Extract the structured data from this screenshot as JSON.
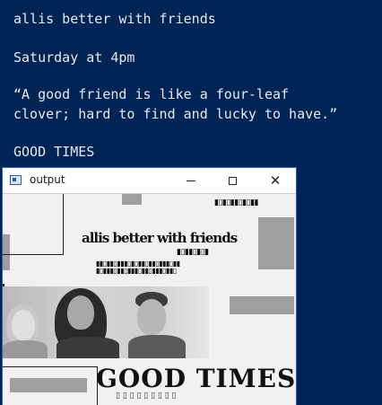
{
  "console": {
    "lines": [
      "allis better with friends",
      "Saturday at 4pm",
      "“A good friend is like a four-leaf",
      "clover; hard to find and lucky to have.”",
      "GOOD TIMES"
    ]
  },
  "window": {
    "title": "output",
    "icon": "app-window-icon",
    "controls": {
      "minimize_icon": "minimize-icon",
      "maximize_icon": "maximize-icon",
      "close_icon": "close-icon",
      "close_glyph": "✕"
    }
  },
  "poster": {
    "headline": "allis better with friends",
    "good_times": "GOOD TIMES"
  },
  "colors": {
    "console_bg": "#012456",
    "console_text": "#e8e8e8",
    "window_bg": "#f3f3f3",
    "title_bar": "#ffffff"
  }
}
